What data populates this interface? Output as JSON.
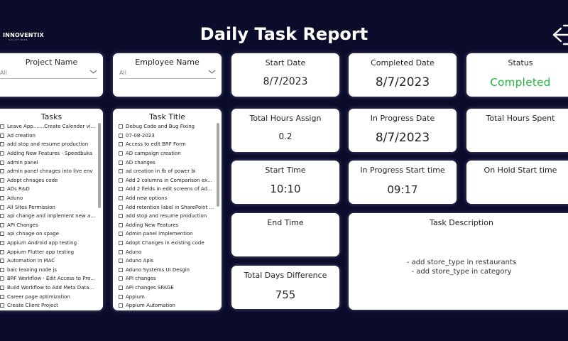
{
  "header": {
    "logo_text": "INNOVENTIX",
    "logo_subtext": "SOLUTIONS",
    "title": "Daily Task Report"
  },
  "filters": {
    "project": {
      "label": "Project Name",
      "value": "All"
    },
    "employee": {
      "label": "Employee Name",
      "value": "All"
    }
  },
  "tasks": {
    "title": "Tasks",
    "items": [
      "Leave App.......Create Calender vie...",
      "Ad creation",
      "add stop and resume production",
      "Adding New Features - Speedbuka",
      "admin panel",
      "admin panel chnages into live env",
      "Adopt chnages code",
      "ADs R&D",
      "Aduno",
      "All Sites Permission",
      "api change and implement new a...",
      "API Changes",
      "api chnage on spage",
      "Appium Android app testing",
      "Appium Flutter app testing",
      "Automation in MAC",
      "baic leaning node js",
      "BRF Workflow - Edit Access to Pro...",
      "Build Workflow to Add Meta Data...",
      "Career page optimization",
      "Create Client Project"
    ]
  },
  "task_titles": {
    "title": "Task Title",
    "items": [
      "Debug Code and Bug Fixing",
      "07-08-2023",
      "Access to edit BRF Form",
      "AD campaign creation",
      "AD changes",
      "ad creation in fb of power bi",
      "Add 2 columns in Comparison exc...",
      "Add 2 fields in edit screens of Ad...",
      "Add new options",
      "Add retention label in SharePoint ...",
      "add stop and resume production",
      "Adding New Features",
      "Admin panel implemention",
      "Adopt Changes in existing code",
      "Aduno",
      "Aduno Apis",
      "Aduno Systems UI Desgin",
      "API changes",
      "API changes SPAGE",
      "Appium",
      "Appium Automation"
    ]
  },
  "cards": {
    "start_date": {
      "label": "Start Date",
      "value": "8/7/2023"
    },
    "completed_date": {
      "label": "Completed Date",
      "value": "8/7/2023"
    },
    "status": {
      "label": "Status",
      "value": "Completed"
    },
    "total_hours_assign": {
      "label": "Total Hours Assign",
      "value": "0.2"
    },
    "in_progress_date": {
      "label": "In Progress Date",
      "value": "8/7/2023"
    },
    "total_hours_spent": {
      "label": "Total Hours Spent",
      "value": ""
    },
    "start_time": {
      "label": "Start Time",
      "value": "10:10"
    },
    "in_progress_start_time": {
      "label": "In Progress Start time",
      "value": "09:17"
    },
    "on_hold_start_time": {
      "label": "On Hold Start time",
      "value": ""
    },
    "end_time": {
      "label": "End Time",
      "value": ""
    },
    "total_days_difference": {
      "label": "Total Days Difference",
      "value": "755"
    },
    "task_description": {
      "label": "Task Description",
      "lines": [
        "- add store_type in restaurants",
        "- add store_type in category"
      ]
    }
  },
  "colors": {
    "background": "#0b0b2a",
    "status_completed": "#1db53a"
  },
  "icons": {
    "back": "back-arrow-icon",
    "dropdown": "chevron-down-icon",
    "checkbox": "checkbox-icon"
  }
}
